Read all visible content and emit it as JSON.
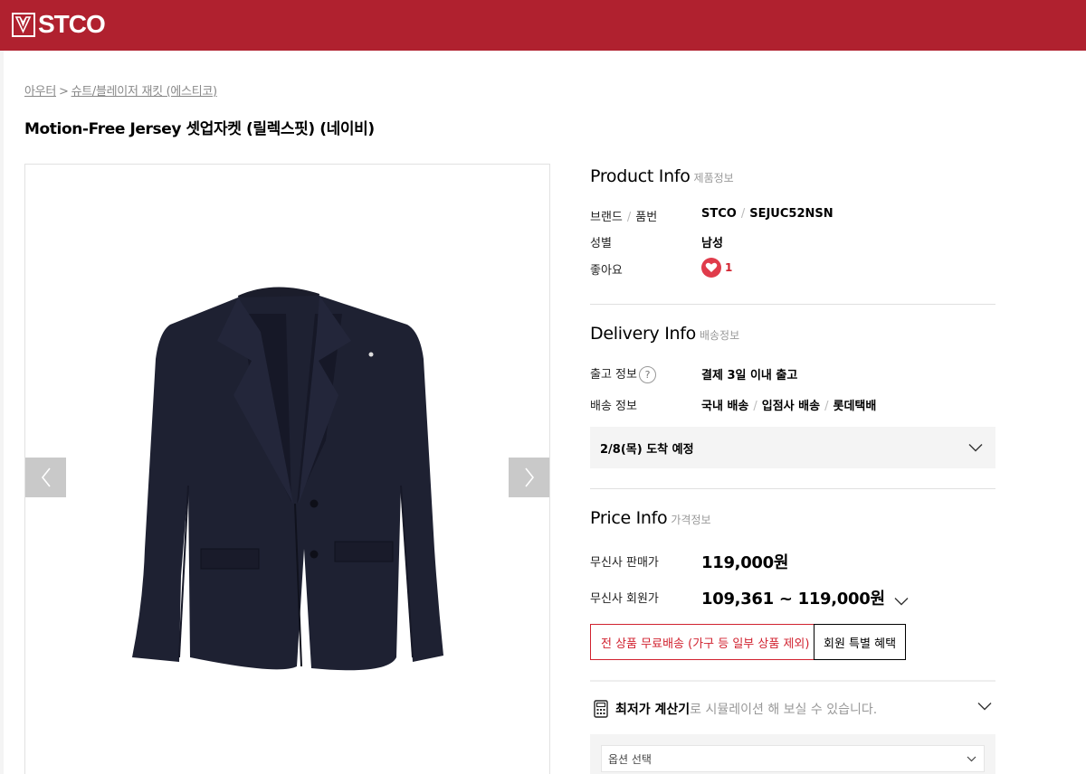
{
  "header": {
    "logo_text": "STCO",
    "brand_color": "#b0212f"
  },
  "breadcrumb": {
    "items": [
      "아우터",
      "슈트/블레이저 재킷 (에스티코)"
    ],
    "separator": ">"
  },
  "product": {
    "title": "Motion-Free Jersey 셋업자켓 (릴렉스핏) (네이비)"
  },
  "gallery": {
    "prev_icon": "chevron-left-icon",
    "next_icon": "chevron-right-icon",
    "image": "navy-blazer-photo"
  },
  "product_info": {
    "title": "Product Info",
    "subtitle": "제품정보",
    "brand_label": "브랜드",
    "partno_label": "품번",
    "brand": "STCO",
    "partno": "SEJUC52NSN",
    "gender_label": "성별",
    "gender": "남성",
    "likes_label": "좋아요",
    "likes": "1"
  },
  "delivery_info": {
    "title": "Delivery Info",
    "subtitle": "배송정보",
    "release_label": "출고 정보",
    "help_icon": "?",
    "release": "결제 3일 이내 출고",
    "shipping_label": "배송 정보",
    "shipping": [
      "국내 배송",
      "입점사 배송",
      "롯데택배"
    ],
    "arrival": "2/8(목) 도착 예정"
  },
  "price_info": {
    "title": "Price Info",
    "subtitle": "가격정보",
    "sale_label": "무신사 판매가",
    "sale_price": "119,000원",
    "member_label": "무신사 회원가",
    "member_price": "109,361 ~ 119,000원",
    "free_shipping_button": "전 상품 무료배송 (가구 등 일부 상품 제외)",
    "member_benefit_button": "회원 특별 혜택",
    "calculator_strong": "최저가 계산기",
    "calculator_rest": "로 시뮬레이션 해 보실 수 있습니다.",
    "option_placeholder": "옵션 선택"
  },
  "colors": {
    "accent_red": "#d1222f",
    "heart": "#e03b4b",
    "muted": "#999999"
  }
}
